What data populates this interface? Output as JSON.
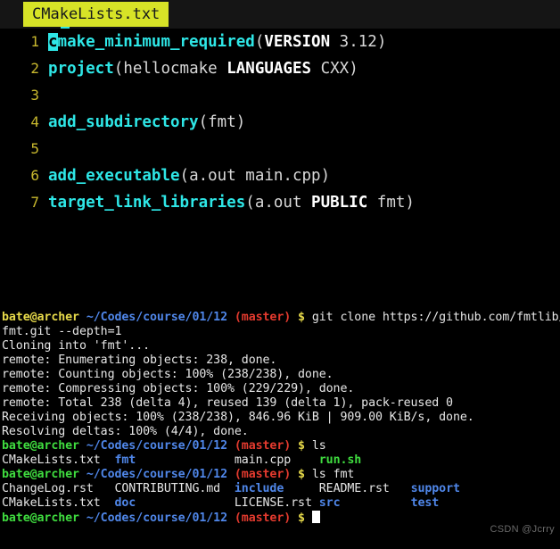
{
  "editor": {
    "tab": {
      "label": "CMakeLists.txt"
    },
    "cursor_char": "c",
    "lines": [
      {
        "num": "1",
        "fn": "make_minimum_required",
        "open": "(",
        "kw": "VERSION",
        "sp": " ",
        "args": "3.12",
        "close": ")"
      },
      {
        "num": "2",
        "fn": "project",
        "open": "(",
        "pre": "hellocmake ",
        "kw": "LANGUAGES",
        "sp": " ",
        "args": "CXX",
        "close": ")"
      },
      {
        "num": "3",
        "fn": "",
        "open": "",
        "kw": "",
        "args": "",
        "close": ""
      },
      {
        "num": "4",
        "fn": "add_subdirectory",
        "open": "(",
        "kw": "",
        "args": "fmt",
        "close": ")"
      },
      {
        "num": "5",
        "fn": "",
        "open": "",
        "kw": "",
        "args": "",
        "close": ""
      },
      {
        "num": "6",
        "fn": "add_executable",
        "open": "(",
        "kw": "",
        "args": "a.out main.cpp",
        "close": ")"
      },
      {
        "num": "7",
        "fn": "target_link_libraries",
        "open": "(",
        "pre": "a.out ",
        "kw": "PUBLIC",
        "sp": " ",
        "args": "fmt",
        "close": ")"
      }
    ]
  },
  "terminal": {
    "prompt": {
      "user": "bate@archer",
      "path": "~/Codes/course/01/12",
      "branch": "(master)",
      "sigil": "$"
    },
    "lines": [
      {
        "type": "prompt",
        "color": "yellow",
        "command": "git clone https://github.com/fmtlib/"
      },
      {
        "type": "output",
        "text": "fmt.git --depth=1"
      },
      {
        "type": "output",
        "text": "Cloning into 'fmt'..."
      },
      {
        "type": "output",
        "text": "remote: Enumerating objects: 238, done."
      },
      {
        "type": "output",
        "text": "remote: Counting objects: 100% (238/238), done."
      },
      {
        "type": "output",
        "text": "remote: Compressing objects: 100% (229/229), done."
      },
      {
        "type": "output",
        "text": "remote: Total 238 (delta 4), reused 139 (delta 1), pack-reused 0"
      },
      {
        "type": "output",
        "text": "Receiving objects: 100% (238/238), 846.96 KiB | 909.00 KiB/s, done."
      },
      {
        "type": "output",
        "text": "Resolving deltas: 100% (4/4), done."
      },
      {
        "type": "prompt",
        "color": "green",
        "command": "ls"
      },
      {
        "type": "listing",
        "items": [
          {
            "name": "CMakeLists.txt",
            "kind": "file"
          },
          {
            "name": "fmt",
            "kind": "dir"
          },
          {
            "name": "main.cpp",
            "kind": "file"
          },
          {
            "name": "run.sh",
            "kind": "exec"
          }
        ]
      },
      {
        "type": "prompt",
        "color": "green",
        "command": "ls fmt"
      },
      {
        "type": "listing",
        "items": [
          {
            "name": "ChangeLog.rst",
            "kind": "file"
          },
          {
            "name": "CONTRIBUTING.md",
            "kind": "file"
          },
          {
            "name": "include",
            "kind": "dir"
          },
          {
            "name": "README.rst",
            "kind": "file"
          },
          {
            "name": "support",
            "kind": "dir"
          }
        ]
      },
      {
        "type": "listing",
        "items": [
          {
            "name": "CMakeLists.txt",
            "kind": "file"
          },
          {
            "name": "doc",
            "kind": "dir"
          },
          {
            "name": "LICENSE.rst",
            "kind": "file"
          },
          {
            "name": "src",
            "kind": "dir"
          },
          {
            "name": "test",
            "kind": "dir"
          }
        ]
      },
      {
        "type": "prompt",
        "color": "green",
        "command": "",
        "cursor": true
      }
    ]
  },
  "watermark": {
    "text": "CSDN @Jcrry"
  },
  "colors": {
    "tab_bg": "#d7e327",
    "function": "#2ee6e6",
    "keyword": "#ffffff",
    "linenum": "#c8b82e",
    "prompt_user_green": "#3fdc3f",
    "prompt_user_yellow": "#e6d94a",
    "prompt_path": "#4f86e8",
    "prompt_branch": "#e33a2e",
    "dir": "#4f86e8",
    "exec": "#3fdc3f",
    "background": "#000000"
  }
}
